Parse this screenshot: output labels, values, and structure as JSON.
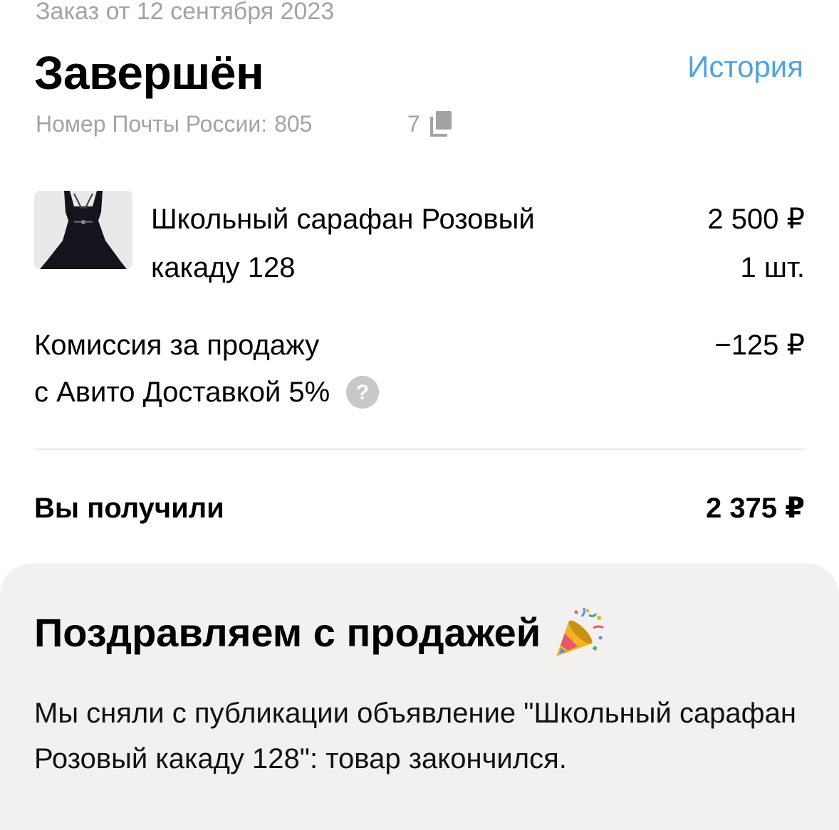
{
  "order": {
    "date_line": "Заказ от 12 сентября 2023",
    "status": "Завершён",
    "history_link": "История",
    "tracking_label": "Номер Почты России:",
    "tracking_value": "805               7"
  },
  "product": {
    "title": "Школьный сарафан Розовый какаду 128",
    "price": "2 500 ₽",
    "quantity": "1 шт.",
    "thumbnail_icon": "dress-thumbnail"
  },
  "commission": {
    "label_line1": "Комиссия за продажу",
    "label_line2": "с Авито Доставкой 5%",
    "value": "−125 ₽",
    "help_icon": "question-circle-icon"
  },
  "total": {
    "label": "Вы получили",
    "value": "2 375 ₽"
  },
  "congrats": {
    "title": "Поздравляем с продажей",
    "icon": "party-popper-icon",
    "text": "Мы сняли с публикации объявление \"Школьный сарафан Розовый какаду 128\": товар закончился."
  },
  "colors": {
    "link": "#4fa3e0",
    "muted": "#a3a3a3",
    "card_background": "#f2f1f0",
    "divider": "#e8e8e8"
  }
}
